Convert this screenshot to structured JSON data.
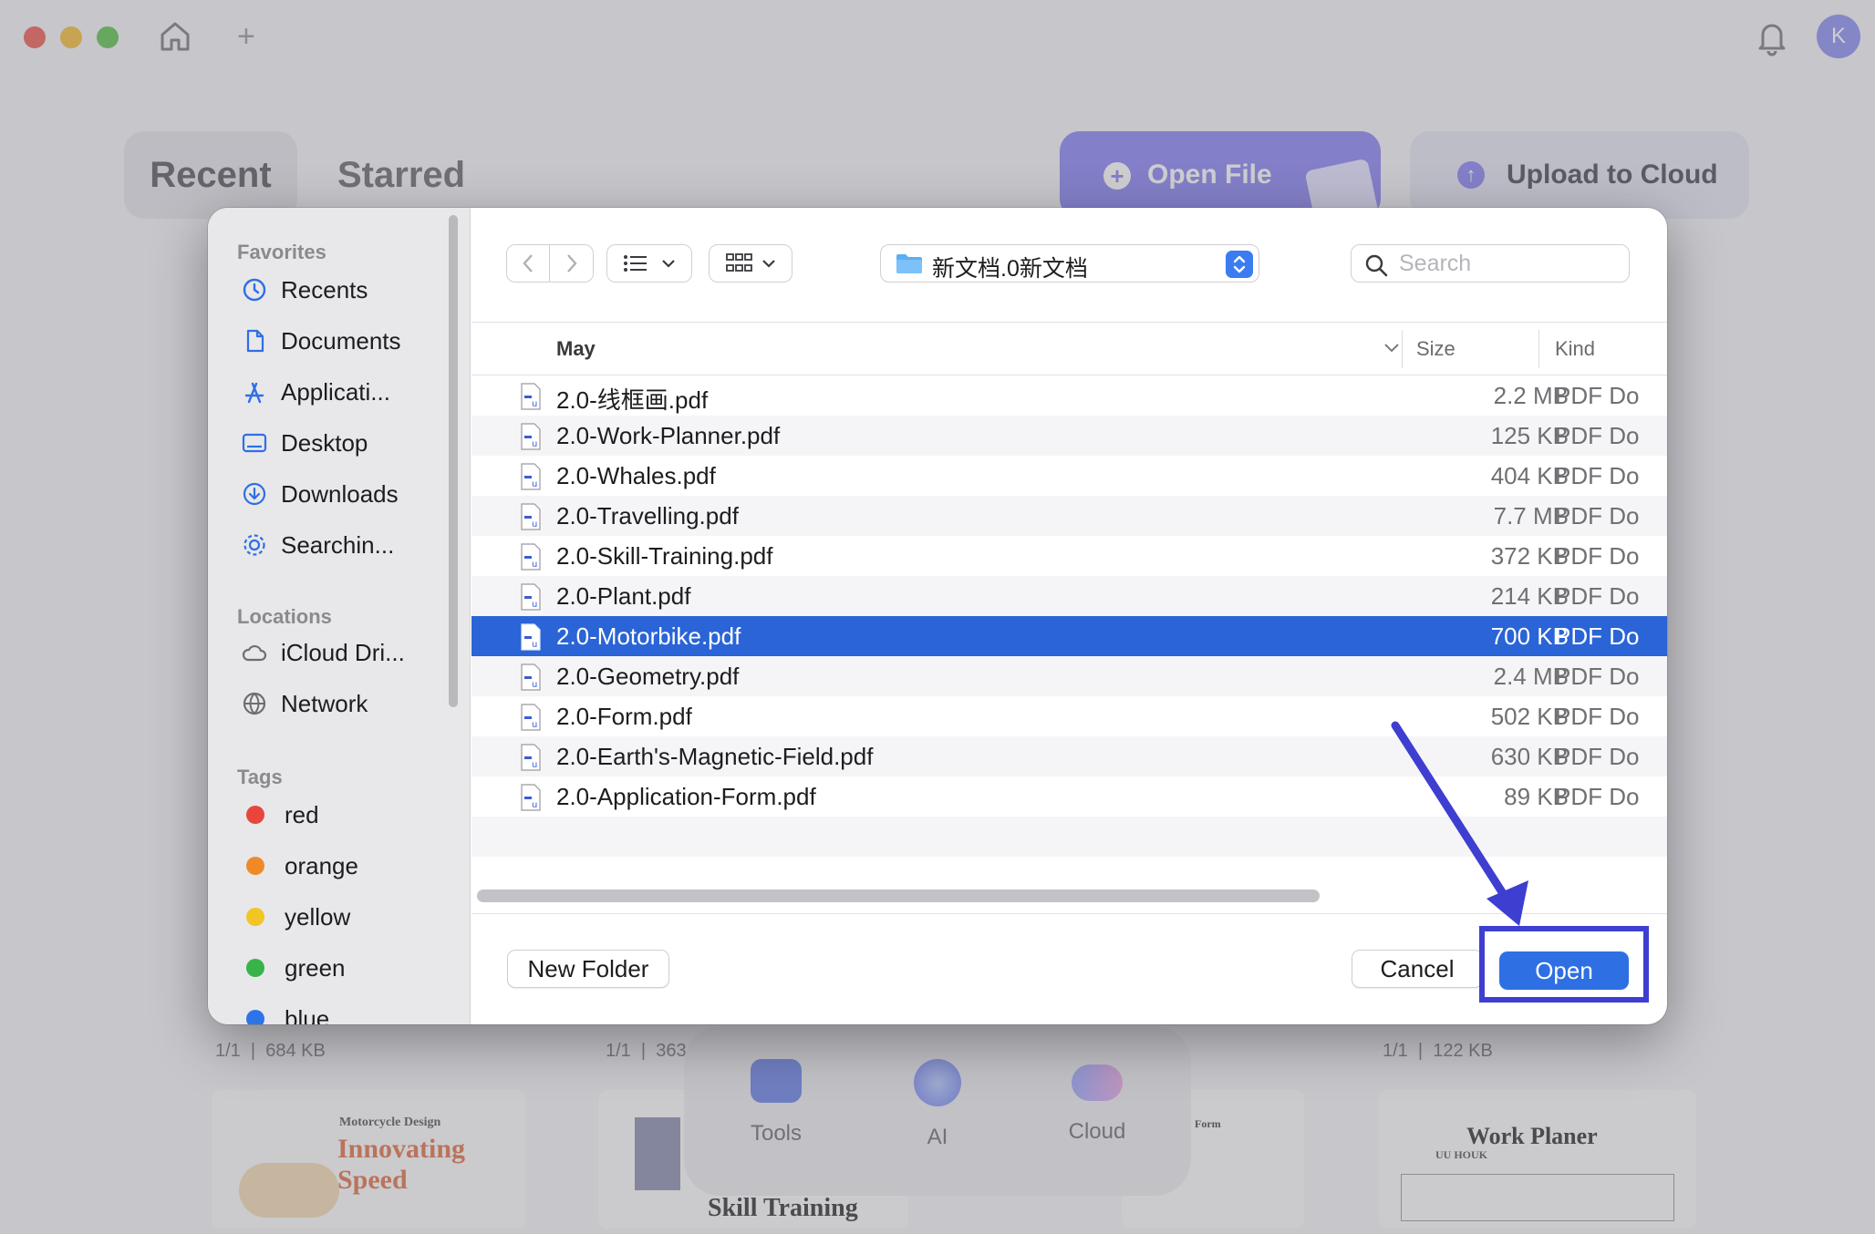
{
  "app": {
    "tabs": {
      "recent": "Recent",
      "starred": "Starred"
    },
    "open_file_label": "Open File",
    "upload_label": "Upload to Cloud",
    "avatar_initial": "K",
    "new_tab": "+",
    "recent_files": [
      {
        "pages": "1/1",
        "size": "684 KB",
        "thumb_title": "Innovating Speed",
        "thumb_sub": "Motorcycle Design"
      },
      {
        "pages": "1/1",
        "size": "363",
        "thumb_title": "Skill Training"
      },
      {
        "pages": "1/1",
        "size": "122 KB",
        "thumb_title": "Work Planer",
        "thumb_sub": "UU HOUK"
      }
    ],
    "form_thumb_title": "Form",
    "dock": [
      {
        "label": "Tools",
        "icon": "toolbox-icon"
      },
      {
        "label": "AI",
        "icon": "ai-orb-icon"
      },
      {
        "label": "Cloud",
        "icon": "cloud-icon"
      }
    ]
  },
  "dialog": {
    "sidebar": {
      "favorites_title": "Favorites",
      "favorites": [
        {
          "label": "Recents",
          "icon": "clock-icon"
        },
        {
          "label": "Documents",
          "icon": "document-icon"
        },
        {
          "label": "Applicati...",
          "icon": "applications-icon"
        },
        {
          "label": "Desktop",
          "icon": "desktop-icon"
        },
        {
          "label": "Downloads",
          "icon": "download-icon"
        },
        {
          "label": "Searchin...",
          "icon": "gear-icon"
        }
      ],
      "locations_title": "Locations",
      "locations": [
        {
          "label": "iCloud Dri...",
          "icon": "cloud-icon"
        },
        {
          "label": "Network",
          "icon": "globe-icon"
        }
      ],
      "tags_title": "Tags",
      "tags": [
        {
          "label": "red",
          "color": "#e8453c"
        },
        {
          "label": "orange",
          "color": "#f0892a"
        },
        {
          "label": "yellow",
          "color": "#f2c524"
        },
        {
          "label": "green",
          "color": "#37b34a"
        },
        {
          "label": "blue",
          "color": "#2d74e8"
        }
      ]
    },
    "path_label": "新文档.0新文档",
    "search_placeholder": "Search",
    "columns": {
      "name": "May",
      "size": "Size",
      "kind": "Kind"
    },
    "files": [
      {
        "name": "2.0-线框画.pdf",
        "size": "2.2 MB",
        "kind": "PDF Do"
      },
      {
        "name": "2.0-Work-Planner.pdf",
        "size": "125 KB",
        "kind": "PDF Do"
      },
      {
        "name": "2.0-Whales.pdf",
        "size": "404 KB",
        "kind": "PDF Do"
      },
      {
        "name": "2.0-Travelling.pdf",
        "size": "7.7 MB",
        "kind": "PDF Do"
      },
      {
        "name": "2.0-Skill-Training.pdf",
        "size": "372 KB",
        "kind": "PDF Do"
      },
      {
        "name": "2.0-Plant.pdf",
        "size": "214 KB",
        "kind": "PDF Do"
      },
      {
        "name": "2.0-Motorbike.pdf",
        "size": "700 KB",
        "kind": "PDF Do",
        "selected": true
      },
      {
        "name": "2.0-Geometry.pdf",
        "size": "2.4 MB",
        "kind": "PDF Do"
      },
      {
        "name": "2.0-Form.pdf",
        "size": "502 KB",
        "kind": "PDF Do"
      },
      {
        "name": "2.0-Earth's-Magnetic-Field.pdf",
        "size": "630 KB",
        "kind": "PDF Do"
      },
      {
        "name": "2.0-Application-Form.pdf",
        "size": "89 KB",
        "kind": "PDF Do"
      }
    ],
    "buttons": {
      "new_folder": "New Folder",
      "cancel": "Cancel",
      "open": "Open"
    }
  },
  "colors": {
    "accent": "#2f6fe4",
    "selection": "#2a64d6",
    "brand": "#8a84f2",
    "annotation": "#3e3ed0"
  }
}
